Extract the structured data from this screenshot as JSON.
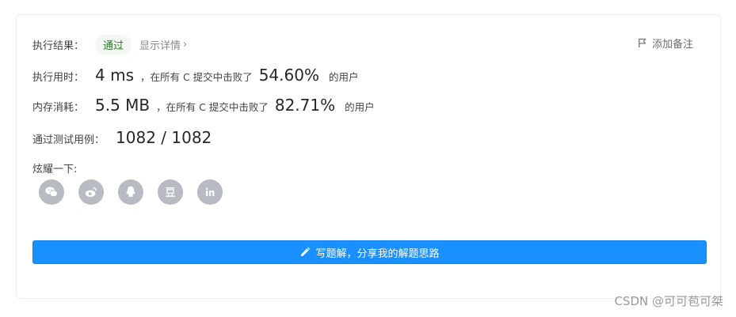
{
  "result": {
    "label": "执行结果：",
    "status": "通过",
    "details_link": "显示详情",
    "chevron": "›"
  },
  "add_note": {
    "label": "添加备注",
    "icon": "flag-icon"
  },
  "runtime": {
    "label": "执行用时：",
    "value": "4 ms",
    "beat_text": "，在所有 C 提交中击败了",
    "percent": "54.60%",
    "tail": "的用户"
  },
  "memory": {
    "label": "内存消耗：",
    "value": "5.5 MB",
    "beat_text": "，在所有 C 提交中击败了",
    "percent": "82.71%",
    "tail": "的用户"
  },
  "tests": {
    "label": "通过测试用例：",
    "value": "1082 / 1082"
  },
  "share": {
    "label": "炫耀一下:",
    "icons": [
      "wechat-icon",
      "weibo-icon",
      "qq-icon",
      "douban-icon",
      "linkedin-icon"
    ]
  },
  "write_button": {
    "label": "写题解，分享我的解题思路",
    "icon": "pencil-icon"
  },
  "watermark": "CSDN @可可苞可桀",
  "colors": {
    "accent": "#1890ff",
    "success": "#2d7a2d",
    "icon_gray": "#b8bcc2"
  }
}
